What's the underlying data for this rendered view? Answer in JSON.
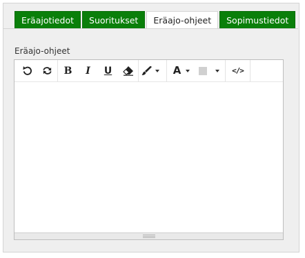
{
  "tabs": [
    {
      "label": "Eräajotiedot",
      "active": false
    },
    {
      "label": "Suoritukset",
      "active": false
    },
    {
      "label": "Eräajo-ohjeet",
      "active": true
    },
    {
      "label": "Sopimustiedot",
      "active": false
    }
  ],
  "field": {
    "label": "Eräajo-ohjeet"
  },
  "toolbar": {
    "undo_icon": "undo-icon",
    "redo_icon": "redo-icon",
    "bold_glyph": "B",
    "italic_glyph": "I",
    "underline_glyph": "U",
    "eraser_icon": "eraser-icon",
    "style_icon": "brush-icon",
    "font_color_glyph": "A",
    "background_color_icon": "color-swatch-icon",
    "code_view_glyph": "</>"
  },
  "colors": {
    "tab_green": "#0a7f0a",
    "panel_bg": "#efefef",
    "swatch": "#d0d0d0"
  },
  "editor": {
    "content": ""
  }
}
